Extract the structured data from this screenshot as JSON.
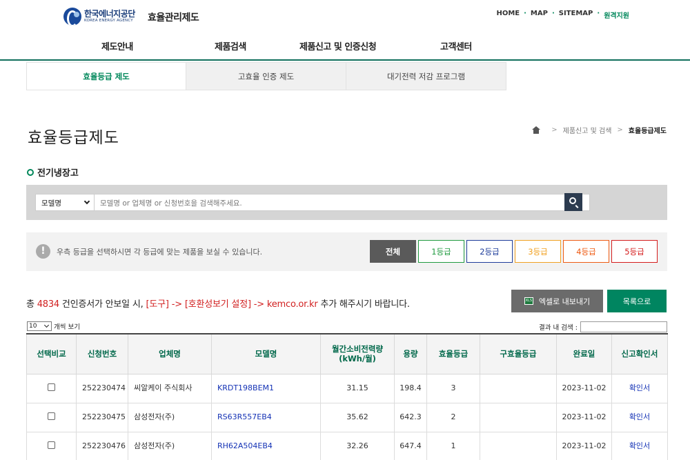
{
  "header": {
    "org_name_ko": "한국에너지공단",
    "org_name_en": "KOREA ENERGY AGENCY",
    "site_title": "효율관리제도",
    "util_nav": [
      "HOME",
      "MAP",
      "SITEMAP",
      "원격지원"
    ]
  },
  "gnb": [
    "제도안내",
    "제품검색",
    "제품신고 및 인증신청",
    "고객센터"
  ],
  "subtabs": [
    {
      "label": "효율등급 제도",
      "active": true
    },
    {
      "label": "고효율 인증 제도",
      "active": false
    },
    {
      "label": "대기전력 저감 프로그램",
      "active": false
    }
  ],
  "page": {
    "title": "효율등급제도",
    "breadcrumb": [
      "제품신고 및 검색",
      "효율등급제도"
    ],
    "category": "전기냉장고"
  },
  "search": {
    "field_selected": "모델명",
    "placeholder": "모델명 or 업체명 or 신청번호을 검색해주세요."
  },
  "grade_filter": {
    "hint": "우측 등급을 선택하시면 각 등급에 맞는 제품을 보실 수 있습니다.",
    "buttons": [
      {
        "label": "전체",
        "color": "#5a5a5a",
        "active": true
      },
      {
        "label": "1등급",
        "color": "#1f9a3f",
        "active": false
      },
      {
        "label": "2등급",
        "color": "#1d3c9a",
        "active": false
      },
      {
        "label": "3등급",
        "color": "#f0a020",
        "active": false
      },
      {
        "label": "4등급",
        "color": "#ee5a12",
        "active": false
      },
      {
        "label": "5등급",
        "color": "#d41b1b",
        "active": false
      }
    ]
  },
  "notice": {
    "prefix": "총 ",
    "count": "4834",
    "middle": " 건인증서가 안보일 시, ",
    "path": "[도구] -> [호환성보기 설정] -> kemco.or.kr",
    "suffix": " 추가 해주시기 바랍니다."
  },
  "actions": {
    "excel_label": "엑셀로 내보내기",
    "excel_icon_text": "XLS",
    "list_label": "목록으로"
  },
  "table_controls": {
    "page_size": "10",
    "page_size_suffix": "개씩 보기",
    "in_search_label": "결과 내 검색 :"
  },
  "table": {
    "headers": [
      "선택비교",
      "신청번호",
      "업체명",
      "모델명",
      "월간소비전력량(kWh/월)",
      "용량",
      "효율등급",
      "구효율등급",
      "완료일",
      "신고확인서"
    ],
    "rows": [
      {
        "app_no": "252230474",
        "company": "씨알케이 주식회사",
        "model": "KRDT198BEM1",
        "power": "31.15",
        "capacity": "198.4",
        "grade": "3",
        "old_grade": "",
        "date": "2023-11-02",
        "cert": "확인서"
      },
      {
        "app_no": "252230475",
        "company": "삼성전자(주)",
        "model": "RS63R557EB4",
        "power": "35.62",
        "capacity": "642.3",
        "grade": "2",
        "old_grade": "",
        "date": "2023-11-02",
        "cert": "확인서"
      },
      {
        "app_no": "252230476",
        "company": "삼성전자(주)",
        "model": "RH62A504EB4",
        "power": "32.26",
        "capacity": "647.4",
        "grade": "1",
        "old_grade": "",
        "date": "2023-11-02",
        "cert": "확인서"
      }
    ]
  }
}
